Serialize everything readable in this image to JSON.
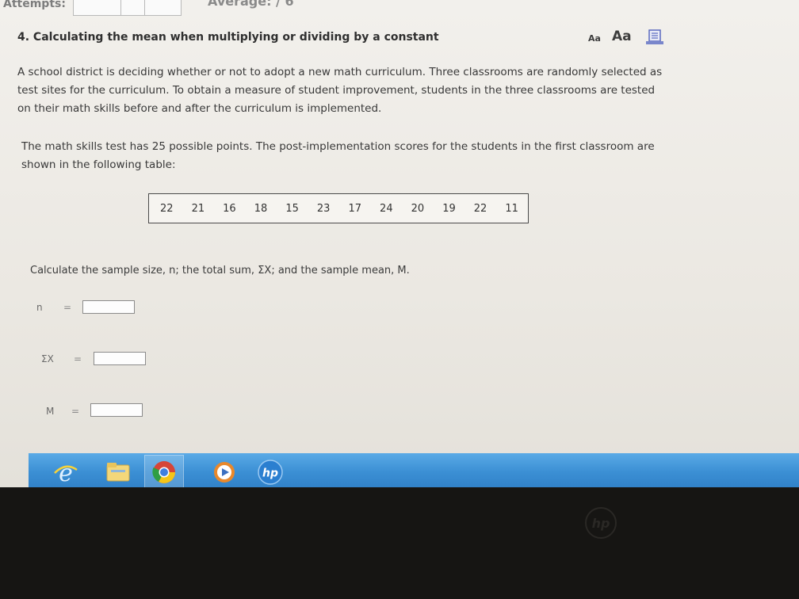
{
  "header": {
    "attempts_label": "Attempts:",
    "average_label": "Average: / 6"
  },
  "question": {
    "title": "4. Calculating the mean when multiplying or dividing by a constant",
    "font_small": "Aa",
    "font_large": "Aa",
    "paragraph1": "A school district is deciding whether or not to adopt a new math curriculum. Three classrooms are randomly selected as test sites for the curriculum. To obtain a measure of student improvement, students in the three classrooms are tested on their math skills before and after the curriculum is implemented.",
    "paragraph2": "The math skills test has 25 possible points. The post-implementation scores for the students in the first classroom are shown in the following table:",
    "scores": [
      "22",
      "21",
      "16",
      "18",
      "15",
      "23",
      "17",
      "24",
      "20",
      "19",
      "22",
      "11"
    ],
    "prompt": "Calculate the sample size, n; the total sum, ΣX; and the sample mean, M."
  },
  "answers": {
    "n_label": "n",
    "n_eq": "=",
    "n_value": "",
    "sum_label": "ΣX",
    "sum_eq": "=",
    "sum_value": "",
    "mean_label": "M",
    "mean_eq": "=",
    "mean_value": ""
  },
  "taskbar": {
    "icons": [
      "internet-explorer-icon",
      "file-explorer-icon",
      "chrome-icon",
      "media-player-icon",
      "hp-icon"
    ],
    "accent": "#3b8fd4"
  },
  "bezel": {
    "logo_text": "hp"
  }
}
